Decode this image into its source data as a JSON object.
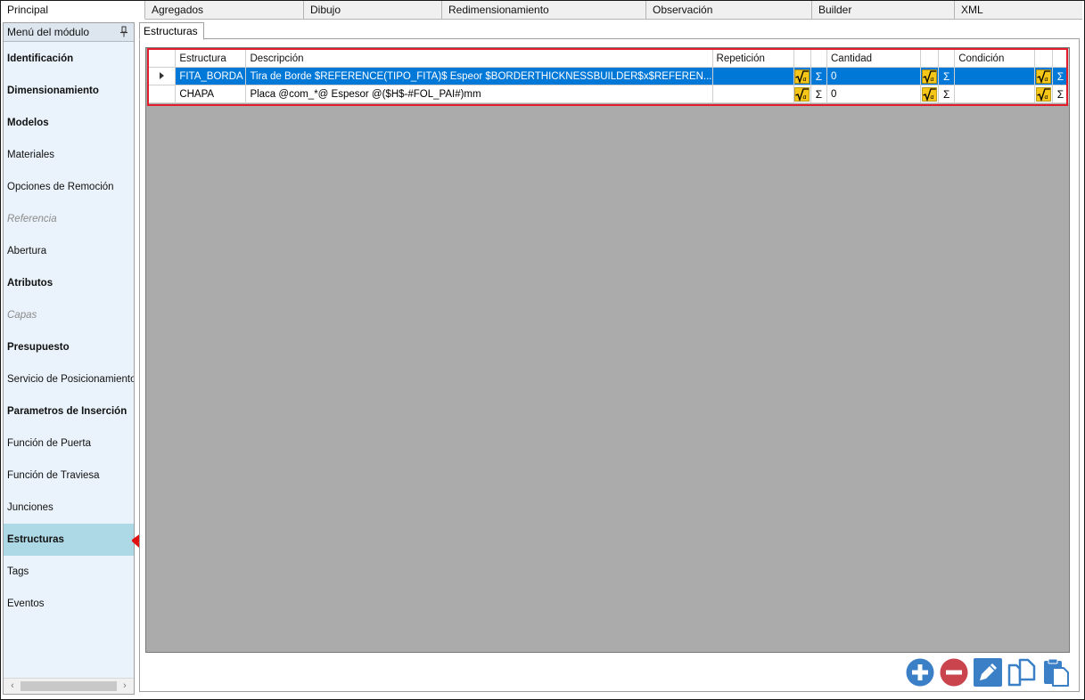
{
  "top_tabs": [
    {
      "label": "Principal",
      "active": true
    },
    {
      "label": "Agregados"
    },
    {
      "label": "Dibujo"
    },
    {
      "label": "Redimensionamiento"
    },
    {
      "label": "Observación"
    },
    {
      "label": "Builder"
    },
    {
      "label": "XML"
    }
  ],
  "sidebar": {
    "title": "Menú del módulo",
    "items": [
      {
        "label": "Identificación",
        "style": "bold"
      },
      {
        "label": "Dimensionamiento",
        "style": "bold"
      },
      {
        "label": "Modelos",
        "style": "bold"
      },
      {
        "label": "Materiales",
        "style": "normal"
      },
      {
        "label": "Opciones de Remoción",
        "style": "normal"
      },
      {
        "label": "Referencia",
        "style": "disabled"
      },
      {
        "label": "Abertura",
        "style": "normal"
      },
      {
        "label": "Atributos",
        "style": "bold"
      },
      {
        "label": "Capas",
        "style": "disabled"
      },
      {
        "label": "Presupuesto",
        "style": "bold"
      },
      {
        "label": "Servicio de Posicionamiento",
        "style": "normal"
      },
      {
        "label": "Parametros de Inserción",
        "style": "bold"
      },
      {
        "label": "Función de Puerta",
        "style": "normal"
      },
      {
        "label": "Función de Traviesa",
        "style": "normal"
      },
      {
        "label": "Junciones",
        "style": "normal"
      },
      {
        "label": "Estructuras",
        "style": "selected"
      },
      {
        "label": "Tags",
        "style": "normal"
      },
      {
        "label": "Eventos",
        "style": "normal"
      }
    ],
    "scroll_left": "‹",
    "scroll_right": "›"
  },
  "content": {
    "tab_label": "Estructuras",
    "grid": {
      "headers": {
        "estructura": "Estructura",
        "descripcion": "Descripción",
        "repeticion": "Repetición",
        "cantidad": "Cantidad",
        "condicion": "Condición"
      },
      "rows": [
        {
          "selected": true,
          "estructura": "FITA_BORDA",
          "descripcion": "Tira de Borde $REFERENCE(TIPO_FITA)$ Espeor $BORDERTHICKNESSBUILDER$x$REFEREN...",
          "repeticion": "",
          "cantidad": "0",
          "condicion": ""
        },
        {
          "selected": false,
          "estructura": "CHAPA",
          "descripcion": "Placa @com_*@ Espesor @($H$-#FOL_PAI#)mm",
          "repeticion": "",
          "cantidad": "0",
          "condicion": ""
        }
      ],
      "sigma_glyph": "Σ"
    }
  },
  "colors": {
    "selection": "#0078d7",
    "sidebar_selected": "#add8e6",
    "grid_background": "#ababab",
    "highlight_red": "#e31b2b",
    "button_blue": "#3b80c6",
    "button_red": "#c9444d"
  }
}
